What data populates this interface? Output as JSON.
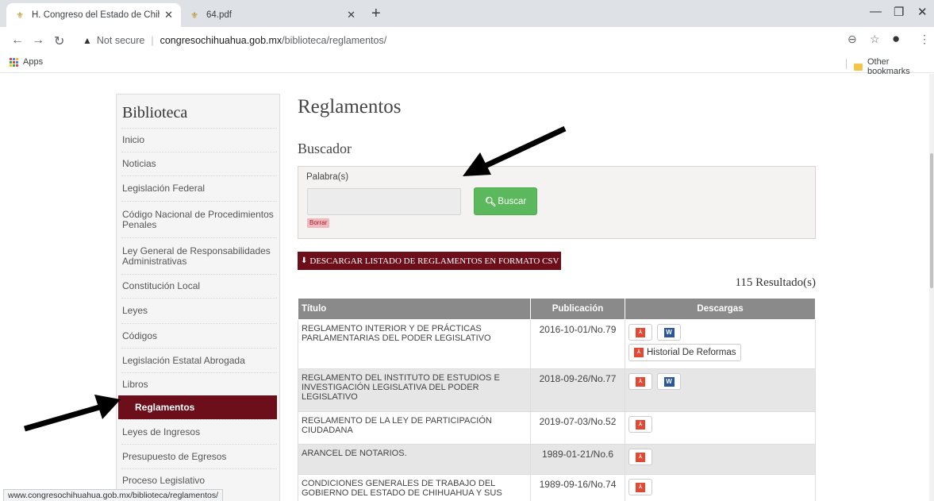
{
  "browser": {
    "tabs": [
      {
        "title": "H. Congreso del Estado de Chihu",
        "active": true
      },
      {
        "title": "64.pdf",
        "active": false
      }
    ],
    "url_security": "Not secure",
    "url_domain": "congresochihuahua.gob.mx",
    "url_path": "/biblioteca/reglamentos/",
    "bookmarks": {
      "apps": "Apps",
      "other": "Other bookmarks"
    },
    "status_url": "www.congresochihuahua.gob.mx/biblioteca/reglamentos/"
  },
  "sidebar": {
    "title": "Biblioteca",
    "items": [
      {
        "label": "Inicio"
      },
      {
        "label": "Noticias"
      },
      {
        "label": "Legislación Federal"
      },
      {
        "label": "Código Nacional de Procedimientos Penales"
      },
      {
        "label": "Ley General de Responsabilidades Administrativas"
      },
      {
        "label": "Constitución Local"
      },
      {
        "label": "Leyes"
      },
      {
        "label": "Códigos"
      },
      {
        "label": "Legislación Estatal Abrogada"
      },
      {
        "label": "Libros"
      },
      {
        "label": "Reglamentos",
        "active": true
      },
      {
        "label": "Leyes de Ingresos"
      },
      {
        "label": "Presupuesto de Egresos"
      },
      {
        "label": "Proceso Legislativo"
      }
    ]
  },
  "main": {
    "title": "Reglamentos",
    "search_heading": "Buscador",
    "search_label": "Palabra(s)",
    "search_value": "",
    "clear_label": "Borrar",
    "search_button": "Buscar",
    "csv_button": "DESCARGAR LISTADO DE REGLAMENTOS EN FORMATO CSV",
    "results_count": "115 Resultado(s)",
    "table": {
      "columns": [
        "Título",
        "Publicación",
        "Descargas"
      ],
      "rows": [
        {
          "title": "REGLAMENTO INTERIOR Y DE PRÁCTICAS PARLAMENTARIAS DEL PODER LEGISLATIVO",
          "date": "2016-10-01/No.79",
          "pdf": true,
          "word": true,
          "history": "Historial De Reformas"
        },
        {
          "title": "REGLAMENTO DEL INSTITUTO DE ESTUDIOS E INVESTIGACIÓN LEGISLATIVA DEL PODER LEGISLATIVO",
          "date": "2018-09-26/No.77",
          "pdf": true,
          "word": true
        },
        {
          "title": "REGLAMENTO DE LA LEY DE PARTICIPACIÓN CIUDADANA",
          "date": "2019-07-03/No.52",
          "pdf": true
        },
        {
          "title": "ARANCEL DE NOTARIOS.",
          "date": "1989-01-21/No.6",
          "pdf": true
        },
        {
          "title": "CONDICIONES GENERALES DE TRABAJO DEL GOBIERNO DEL ESTADO DE CHIHUAHUA Y SUS",
          "date": "1989-09-16/No.74",
          "pdf": true
        }
      ]
    }
  },
  "colors": {
    "accent": "#6d0e1b",
    "search_button": "#5cb85c",
    "table_header": "#8a8a8a"
  },
  "icons": [
    "back-arrow-icon",
    "forward-arrow-icon",
    "reload-icon",
    "warning-icon",
    "zoom-icon",
    "star-icon",
    "profile-icon",
    "menu-icon",
    "pdf-icon",
    "word-icon",
    "search-icon",
    "download-icon"
  ]
}
